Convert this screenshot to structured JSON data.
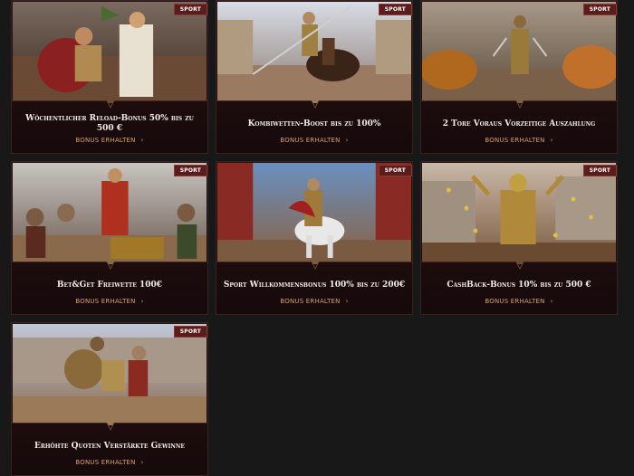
{
  "cards": [
    {
      "tag": "SPORT",
      "title": "Wöchentlicher Reload-Bonus 50% bis zu 500 €",
      "cta": "BONUS ERHALTEN",
      "chevron": "›",
      "scene": "coronation"
    },
    {
      "tag": "SPORT",
      "title": "Kombiwetten-Boost bis zu 100%",
      "cta": "BONUS ERHALTEN",
      "chevron": "›",
      "scene": "horse-rider"
    },
    {
      "tag": "SPORT",
      "title": "2 Tore Voraus Vorzeitige Auszahlung",
      "cta": "BONUS ERHALTEN",
      "chevron": "›",
      "scene": "tigers"
    },
    {
      "tag": "SPORT",
      "title": "Bet&Get Freiwette 100€",
      "cta": "BONUS ERHALTEN",
      "chevron": "›",
      "scene": "treasure"
    },
    {
      "tag": "SPORT",
      "title": "Sport Willkommensbonus 100% bis zu 200€",
      "cta": "BONUS ERHALTEN",
      "chevron": "›",
      "scene": "white-horse"
    },
    {
      "tag": "SPORT",
      "title": "CashBack-Bonus 10% bis zu 500 €",
      "cta": "BONUS ERHALTEN",
      "chevron": "›",
      "scene": "coins"
    },
    {
      "tag": "SPORT",
      "title": "Erhöhte Quoten Verstärkte Gewinne",
      "cta": "BONUS ERHALTEN",
      "chevron": "›",
      "scene": "duel"
    }
  ]
}
